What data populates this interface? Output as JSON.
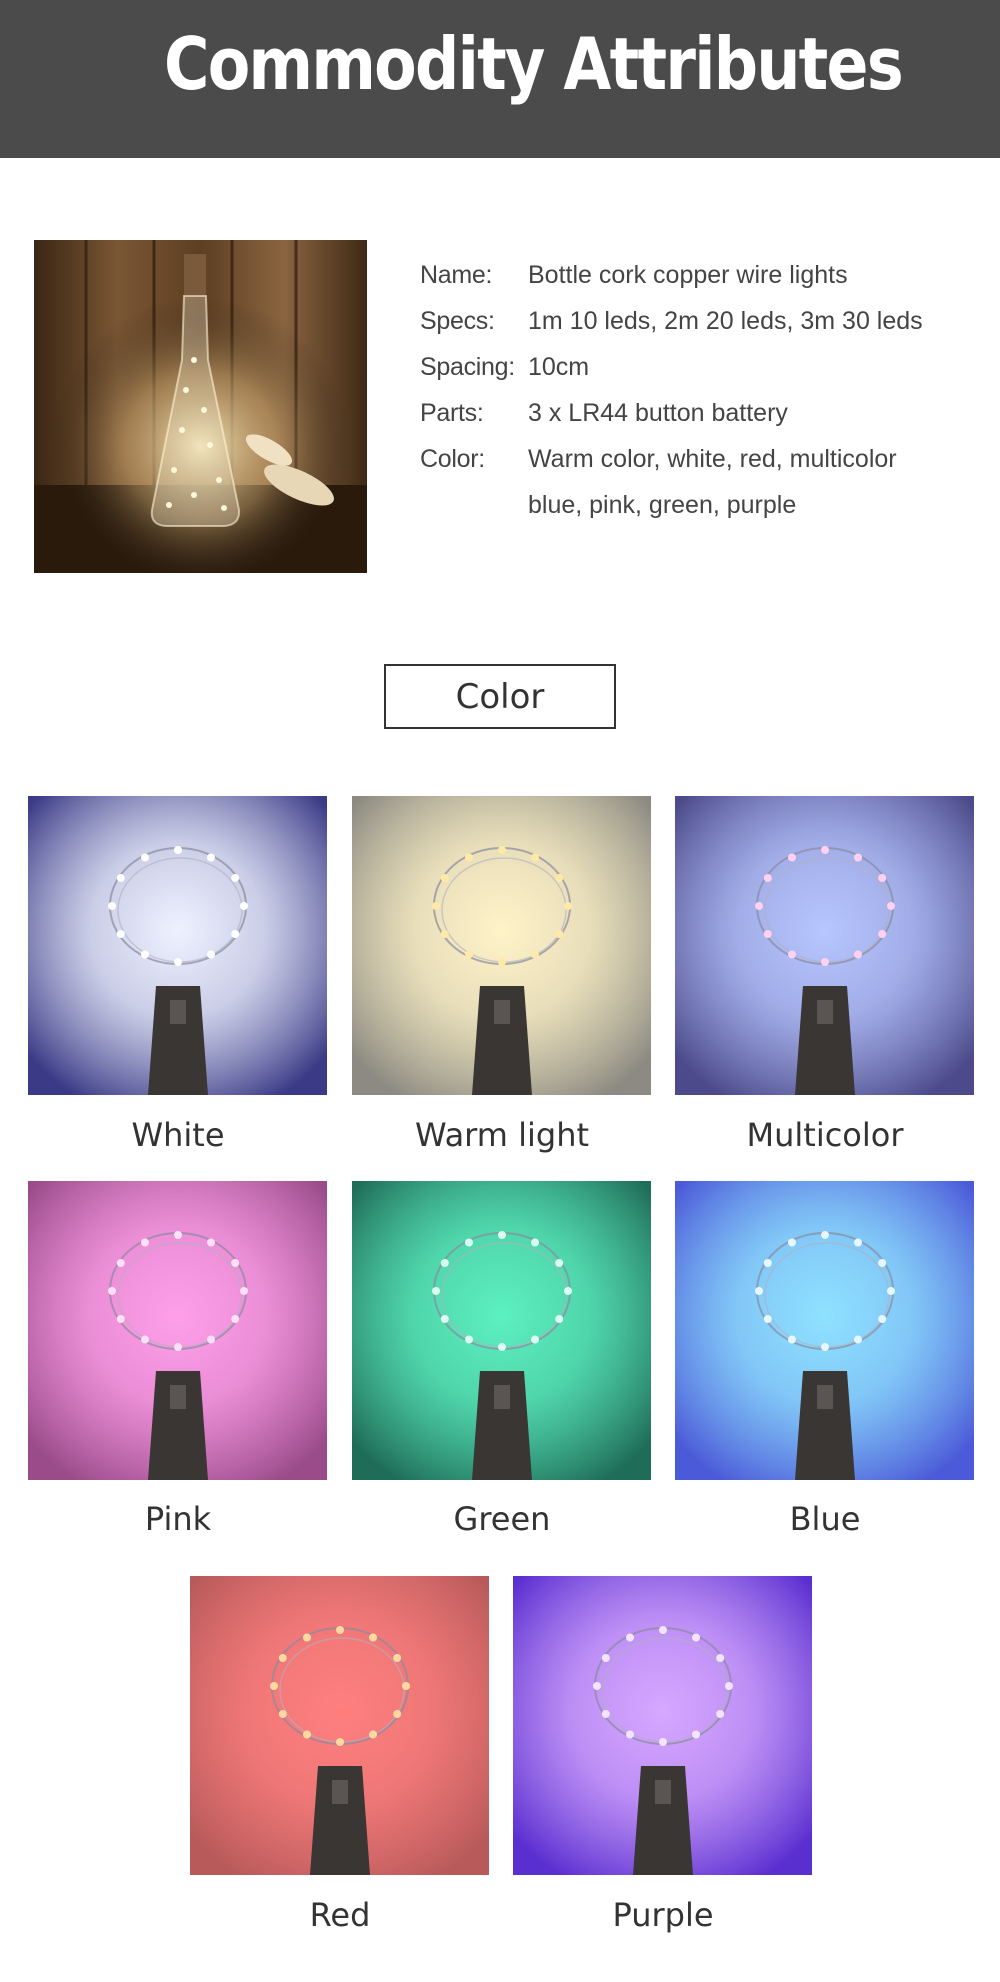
{
  "header": {
    "title": "Commodity Attributes"
  },
  "specs": [
    {
      "label": "Name:",
      "value": "Bottle cork copper wire lights"
    },
    {
      "label": "Specs:",
      "value": "1m 10 leds, 2m 20 leds, 3m 30 leds"
    },
    {
      "label": "Spacing:",
      "value": "10cm"
    },
    {
      "label": "Parts:",
      "value": "3 x LR44 button battery"
    },
    {
      "label": "Color:",
      "value": "Warm color, white, red, multicolor"
    },
    {
      "label": "",
      "value": "blue, pink, green, purple"
    }
  ],
  "color_section": {
    "heading": "Color"
  },
  "variants": [
    {
      "name": "White",
      "glow": "#eef2ff",
      "bg": "#3a3a86",
      "led": "#ffffff"
    },
    {
      "name": "Warm light",
      "glow": "#fff3c8",
      "bg": "#8c8a82",
      "led": "#ffe9a8"
    },
    {
      "name": "Multicolor",
      "glow": "#b7c6ff",
      "bg": "#4c4a8a",
      "led": "#ffd0f0"
    },
    {
      "name": "Pink",
      "glow": "#ff9fea",
      "bg": "#9a4b8a",
      "led": "#ffe0f6"
    },
    {
      "name": "Green",
      "glow": "#5cf0c0",
      "bg": "#1f6d58",
      "led": "#d8fff0"
    },
    {
      "name": "Blue",
      "glow": "#8fe2ff",
      "bg": "#4b5ad8",
      "led": "#e6f7ff"
    },
    {
      "name": "Red",
      "glow": "#ff7f7f",
      "bg": "#b85a5a",
      "led": "#ffd9a0"
    },
    {
      "name": "Purple",
      "glow": "#d7a8ff",
      "bg": "#5a2fd0",
      "led": "#f2e4ff"
    }
  ]
}
